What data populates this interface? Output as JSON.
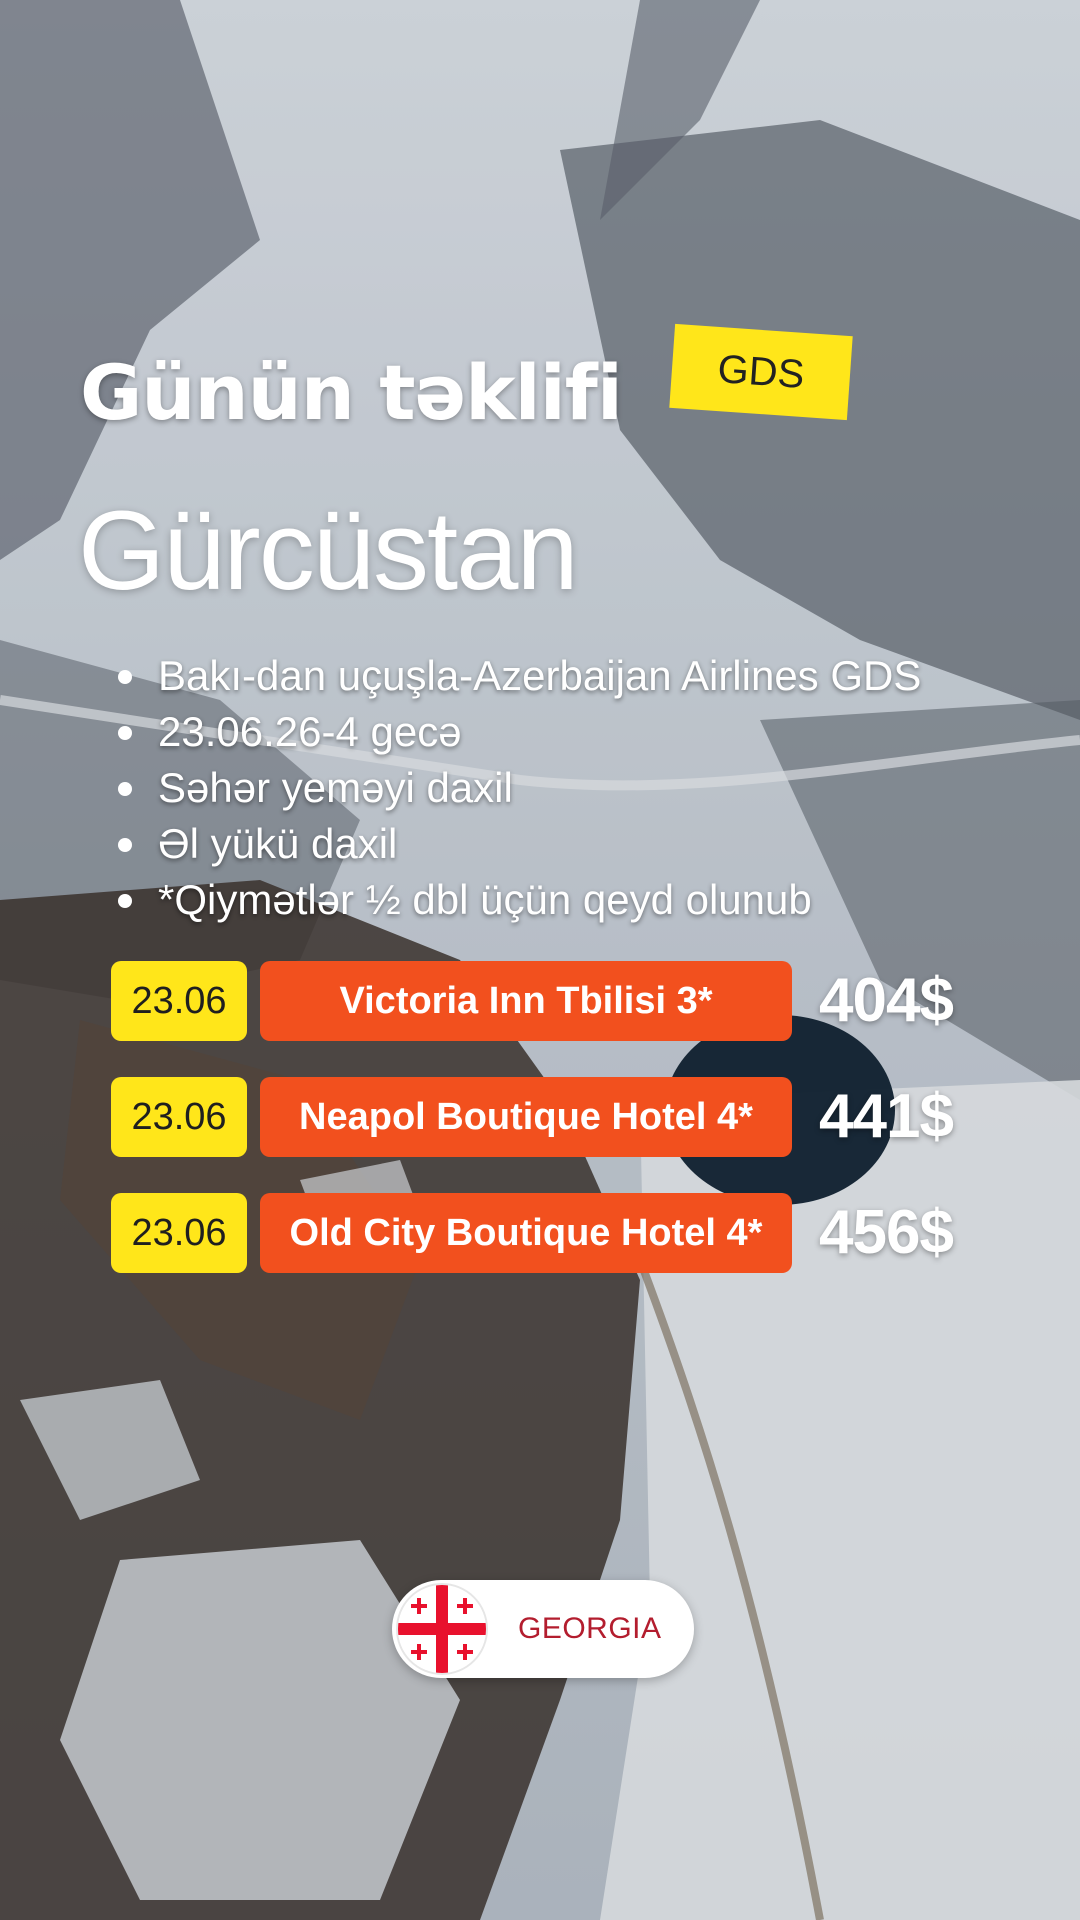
{
  "headline": "Günün təklifi",
  "badge": "GDS",
  "country": "Gürcüstan",
  "details": [
    "Bakı-dan uçuşla-Azerbaijan Airlines GDS",
    "23.06.26-4 gecə",
    "Səhər yeməyi daxil",
    "Əl yükü daxil",
    "*Qiymətlər ½ dbl üçün qeyd olunub"
  ],
  "offers": [
    {
      "date": "23.06",
      "hotel": "Victoria Inn Tbilisi 3*",
      "price": "404$"
    },
    {
      "date": "23.06",
      "hotel": "Neapol Boutique Hotel 4*",
      "price": "441$"
    },
    {
      "date": "23.06",
      "hotel": "Old City Boutique Hotel 4*",
      "price": "456$"
    }
  ],
  "country_pill": {
    "label": "GEORGIA",
    "flag_icon": "georgia-flag-icon"
  },
  "colors": {
    "badge_yellow": "#ffe61a",
    "hotel_orange": "#f2501e",
    "pill_text_red": "#b31d2e",
    "flag_red": "#e8112d"
  }
}
